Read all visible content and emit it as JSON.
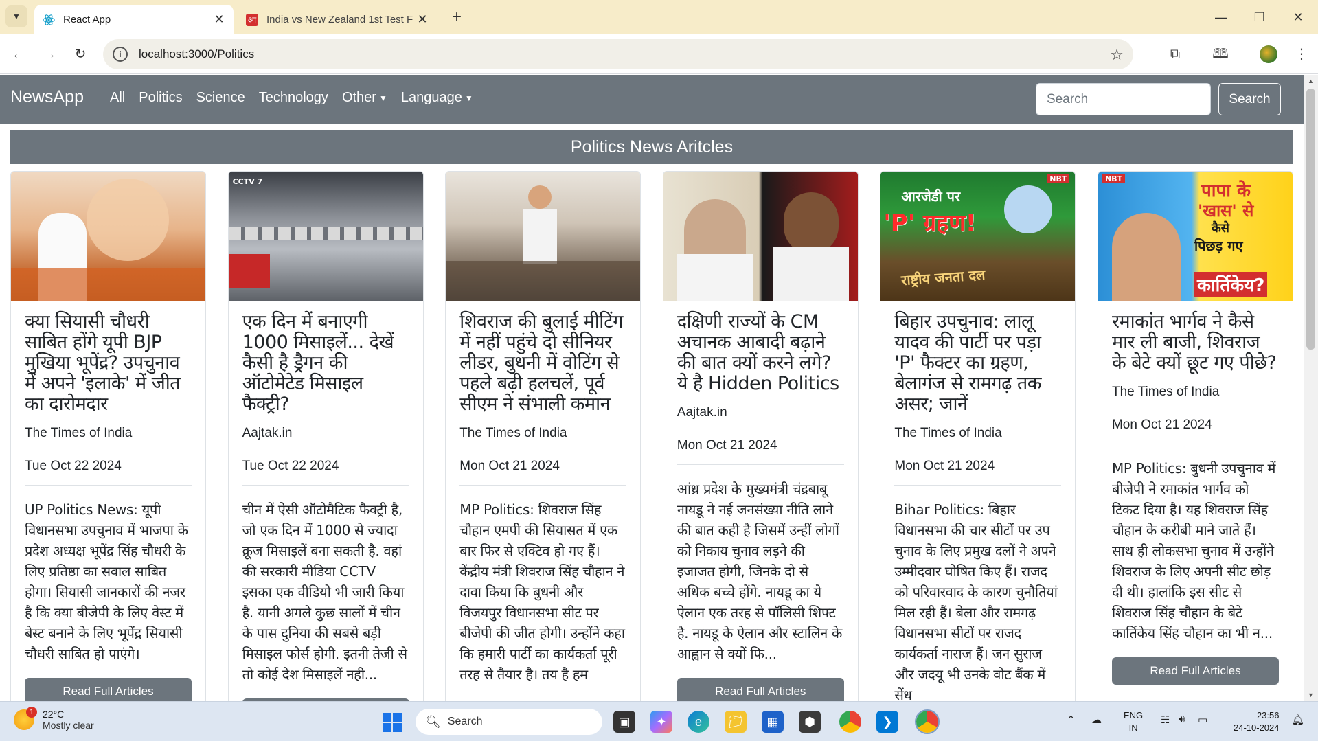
{
  "browser": {
    "tabs": [
      {
        "title": "React App",
        "active": true
      },
      {
        "title": "India vs New Zealand 1st Test F",
        "active": false
      }
    ],
    "url": "localhost:3000/Politics"
  },
  "app": {
    "brand": "NewsApp",
    "nav": {
      "all": "All",
      "politics": "Politics",
      "science": "Science",
      "technology": "Technology",
      "other": "Other",
      "language": "Language"
    },
    "search": {
      "placeholder": "Search",
      "button": "Search"
    },
    "section_title": "Politics News Aritcles",
    "read_button": "Read Full Articles"
  },
  "articles": [
    {
      "title": "क्या सियासी चौधरी साबित होंगे यूपी BJP मुखिया भूपेंद्र? उपचुनाव में अपने 'इलाके' में जीत का दारोमदार",
      "source": "The Times of India",
      "date": "Tue Oct 22 2024",
      "description": "UP Politics News: यूपी विधानसभा उपचुनाव में भाजपा के प्रदेश अध्यक्ष भूपेंद्र सिंह चौधरी के लिए प्रतिष्ठा का सवाल साबित होगा। सियासी जानकारों की नजर है कि क्या बीजेपी के लिए वेस्ट में बेस्ट बनाने के लिए भूपेंद्र सियासी चौधरी साबित हो पाएंगे।"
    },
    {
      "title": "एक दिन में बनाएगी 1000 मिसाइलें... देखें कैसी है ड्रैगन की ऑटोमेटेड मिसाइल फैक्ट्री?",
      "source": "Aajtak.in",
      "date": "Tue Oct 22 2024",
      "description": "चीन में ऐसी ऑटोमैटिक फैक्ट्री है, जो एक दिन में 1000 से ज्यादा क्रूज मिसाइलें बना सकती है. वहां की सरकारी मीडिया CCTV इसका एक वीडियो भी जारी किया है. यानी अगले कुछ सालों में चीन के पास दुनिया की सबसे बड़ी मिसाइल फोर्स होगी. इतनी तेजी से तो कोई देश मिसाइलें नही..."
    },
    {
      "title": "शिवराज की बुलाई मीटिंग में नहीं पहुंचे दो सीनियर लीडर, बुधनी में वोटिंग से पहले बढ़ी हलचलें, पूर्व सीएम ने संभाली कमान",
      "source": "The Times of India",
      "date": "Mon Oct 21 2024",
      "description": "MP Politics: शिवराज सिंह चौहान एमपी की सियासत में एक बार फिर से एक्टिव हो गए हैं। केंद्रीय मंत्री शिवराज सिंह चौहान ने दावा किया कि बुधनी और विजयपुर विधानसभा सीट पर बीजेपी की जीत होगी। उन्होंने कहा कि हमारी पार्टी का कार्यकर्ता पूरी तरह से तैयार है। तय है हम"
    },
    {
      "title": "दक्षिणी राज्यों के CM अचानक आबादी बढ़ाने की बात क्यों करने लगे? ये है Hidden Politics",
      "source": "Aajtak.in",
      "date": "Mon Oct 21 2024",
      "description": "आंध्र प्रदेश के मुख्यमंत्री चंद्रबाबू नायडू ने नई जनसंख्या नीति लाने की बात कही है जिसमें उन्हीं लोगों को निकाय चुनाव लड़ने की इजाजत होगी, जिनके दो से अधिक बच्चे होंगे. नायडू का ये ऐलान एक तरह से पॉलिसी शिफ्ट है. नायडू के ऐलान और स्टालिन के आह्वान से क्यों फि..."
    },
    {
      "title": "बिहार उपचुनाव: लालू यादव की पार्टी पर पड़ा 'P' फैक्टर का ग्रहण, बेलागंज से रामगढ़ तक असर; जानें",
      "source": "The Times of India",
      "date": "Mon Oct 21 2024",
      "description": "Bihar Politics: बिहार विधानसभा की चार सीटों पर उप चुनाव के लिए प्रमुख दलों ने अपने उम्मीदवार घोषित किए हैं। राजद को परिवारवाद के कारण चुनौतियां मिल रही हैं। बेला और रामगढ़ विधानसभा सीटों पर राजद कार्यकर्ता नाराज हैं। जन सुराज और जदयू भी उनके वोट बैंक में सेंध"
    },
    {
      "title": "रमाकांत भार्गव ने कैसे मार ली बाजी, शिवराज के बेटे क्यों छूट गए पीछे?",
      "source": "The Times of India",
      "date": "Mon Oct 21 2024",
      "description": "MP Politics: बुधनी उपचुनाव में बीजेपी ने रमाकांत भार्गव को टिकट दिया है। यह शिवराज सिंह चौहान के करीबी माने जाते हैं। साथ ही लोकसभा चुनाव में उन्होंने शिवराज के लिए अपनी सीट छोड़ दी थी। हालांकि इस सीट से शिवराज सिंह चौहान के बेटे कार्तिकेय सिंह चौहान का भी न..."
    }
  ],
  "thumbnail_text": {
    "img2_tag": "CCTV 7",
    "img5_badge": "NBT",
    "img5_line1": "आरजेडी पर",
    "img5_line2": "'P' ग्रहण!",
    "img5_sign": "राष्ट्रीय जनता दल",
    "img6_badge": "NBT",
    "img6_line1": "पापा के",
    "img6_line2": "'खास' से",
    "img6_line3": "कैसे",
    "img6_line4": "पिछड़ गए",
    "img6_line5": "कार्तिकेय?"
  },
  "taskbar": {
    "weather_temp": "22°C",
    "weather_desc": "Mostly clear",
    "weather_badge": "1",
    "search_label": "Search",
    "lang1": "ENG",
    "lang2": "IN",
    "time": "23:56",
    "date": "24-10-2024"
  }
}
